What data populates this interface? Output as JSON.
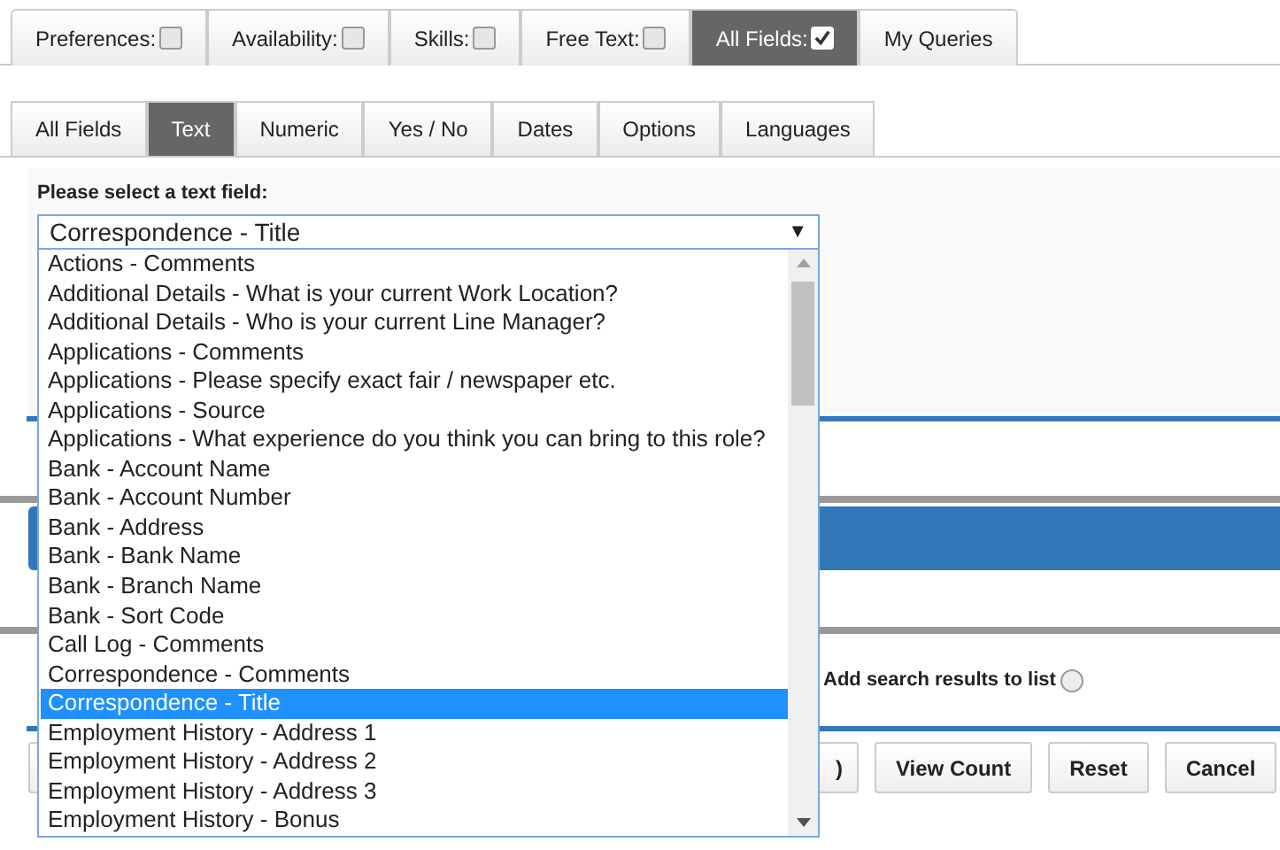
{
  "top_tabs": [
    {
      "label": "Preferences:",
      "checked": false,
      "selected": false
    },
    {
      "label": "Availability:",
      "checked": false,
      "selected": false
    },
    {
      "label": "Skills:",
      "checked": false,
      "selected": false
    },
    {
      "label": "Free Text:",
      "checked": false,
      "selected": false
    },
    {
      "label": "All Fields:",
      "checked": true,
      "selected": true
    },
    {
      "label": "My Queries",
      "selected": false
    }
  ],
  "field_tabs": [
    {
      "label": "All Fields",
      "selected": false
    },
    {
      "label": "Text",
      "selected": true
    },
    {
      "label": "Numeric",
      "selected": false
    },
    {
      "label": "Yes / No",
      "selected": false
    },
    {
      "label": "Dates",
      "selected": false
    },
    {
      "label": "Options",
      "selected": false
    },
    {
      "label": "Languages",
      "selected": false
    }
  ],
  "select_label": "Please select a text field:",
  "select": {
    "value": "Correspondence - Title",
    "arrow": "▼"
  },
  "options": [
    {
      "label": "Actions - Comments",
      "selected": false
    },
    {
      "label": "Additional Details - What is your current Work Location?",
      "selected": false
    },
    {
      "label": "Additional Details - Who is your current Line Manager?",
      "selected": false
    },
    {
      "label": "Applications - Comments",
      "selected": false
    },
    {
      "label": "Applications - Please specify exact fair / newspaper etc.",
      "selected": false
    },
    {
      "label": "Applications - Source",
      "selected": false
    },
    {
      "label": "Applications - What experience do you think you can bring to this role?",
      "selected": false
    },
    {
      "label": "Bank - Account Name",
      "selected": false
    },
    {
      "label": "Bank - Account Number",
      "selected": false
    },
    {
      "label": "Bank - Address",
      "selected": false
    },
    {
      "label": "Bank - Bank Name",
      "selected": false
    },
    {
      "label": "Bank - Branch Name",
      "selected": false
    },
    {
      "label": "Bank - Sort Code",
      "selected": false
    },
    {
      "label": "Call Log - Comments",
      "selected": false
    },
    {
      "label": "Correspondence - Comments",
      "selected": false
    },
    {
      "label": "Correspondence - Title",
      "selected": true
    },
    {
      "label": "Employment History - Address 1",
      "selected": false
    },
    {
      "label": "Employment History - Address 2",
      "selected": false
    },
    {
      "label": "Employment History - Address 3",
      "selected": false
    },
    {
      "label": "Employment History - Bonus",
      "selected": false
    }
  ],
  "add_to_list": {
    "label": "Add search results to list",
    "checked": false
  },
  "buttons": [
    {
      "label": ")"
    },
    {
      "label": "View Count"
    },
    {
      "label": "Reset"
    },
    {
      "label": "Cancel"
    }
  ]
}
